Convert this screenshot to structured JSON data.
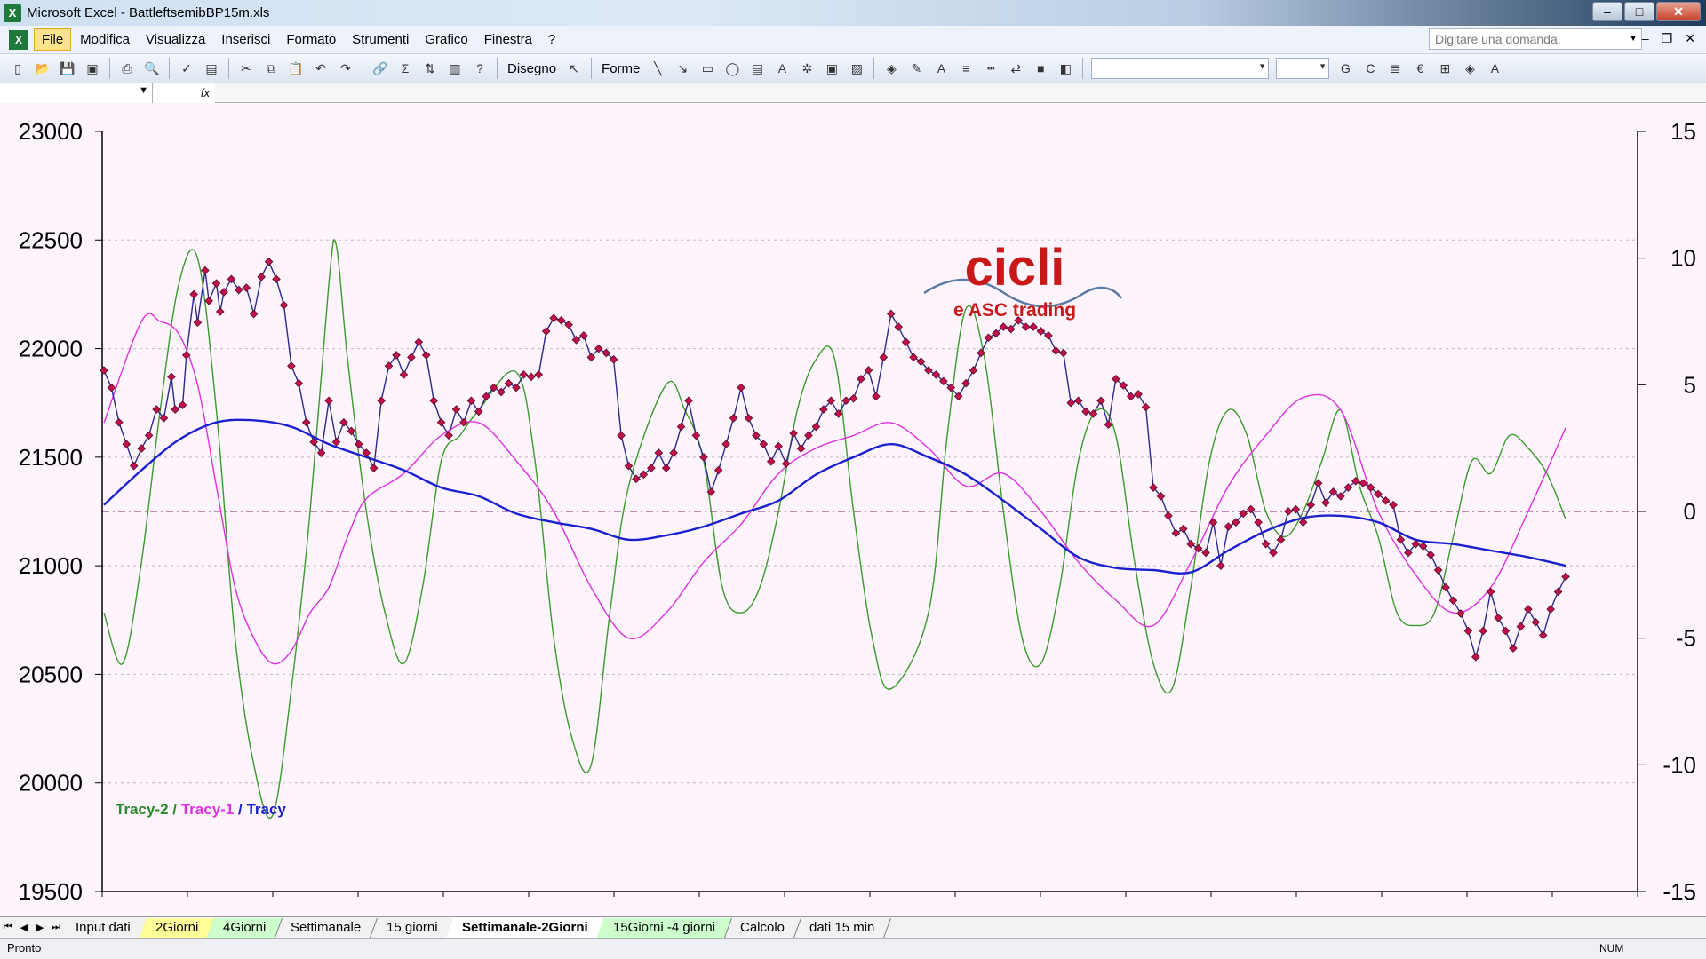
{
  "window": {
    "app": "Microsoft Excel",
    "title": "Microsoft Excel - BattleftsemibBP15m.xls"
  },
  "menu": {
    "items": [
      "File",
      "Modifica",
      "Visualizza",
      "Inserisci",
      "Formato",
      "Strumenti",
      "Grafico",
      "Finestra",
      "?"
    ],
    "ask_placeholder": "Digitare una domanda."
  },
  "toolbar": {
    "drawing_label": "Disegno",
    "shapes_label": "Forme"
  },
  "formula_bar": {
    "fx": "fx"
  },
  "sheet_tabs": [
    {
      "label": "Input dati",
      "style": "plain"
    },
    {
      "label": "2Giorni",
      "style": "yellow"
    },
    {
      "label": "4Giorni",
      "style": "green"
    },
    {
      "label": "Settimanale",
      "style": "plain"
    },
    {
      "label": "15 giorni",
      "style": "plain"
    },
    {
      "label": "Settimanale-2Giorni",
      "style": "active"
    },
    {
      "label": "15Giorni -4 giorni",
      "style": "green"
    },
    {
      "label": "Calcolo",
      "style": "plain"
    },
    {
      "label": "dati 15 min",
      "style": "plain"
    }
  ],
  "status": {
    "left": "Pronto",
    "num": "NUM"
  },
  "logo": {
    "line1": "cicli",
    "line2": "e ASC trading"
  },
  "colors": {
    "tracy2": "#3a9a2a",
    "tracy1": "#e030e0",
    "tracy": "#1a20d0",
    "price": "#2a2a8a",
    "marker": "#c0104a",
    "chart_bg": "#fdf4fd"
  },
  "chart_data": {
    "type": "line",
    "legend": [
      {
        "name": "Tracy-2",
        "color": "#2a8a2a"
      },
      {
        "name": "Tracy-1",
        "color": "#e030e0"
      },
      {
        "name": "Tracy",
        "color": "#1a20d0"
      }
    ],
    "y_left": {
      "min": 19500,
      "max": 23000,
      "ticks": [
        19500,
        20000,
        20500,
        21000,
        21500,
        22000,
        22500,
        23000
      ]
    },
    "y_right": {
      "min": -15,
      "max": 15,
      "ticks": [
        -15,
        -10,
        -5,
        0,
        5,
        10,
        15
      ]
    },
    "n_points": 180,
    "x_ticks": 18,
    "price": [
      [
        0,
        21900
      ],
      [
        2,
        21820
      ],
      [
        4,
        21660
      ],
      [
        6,
        21560
      ],
      [
        8,
        21460
      ],
      [
        10,
        21540
      ],
      [
        12,
        21600
      ],
      [
        14,
        21720
      ],
      [
        16,
        21680
      ],
      [
        18,
        21870
      ],
      [
        19,
        21720
      ],
      [
        21,
        21740
      ],
      [
        22,
        21970
      ],
      [
        24,
        22250
      ],
      [
        25,
        22120
      ],
      [
        27,
        22360
      ],
      [
        28,
        22220
      ],
      [
        30,
        22300
      ],
      [
        31,
        22170
      ],
      [
        32,
        22260
      ],
      [
        34,
        22320
      ],
      [
        36,
        22270
      ],
      [
        38,
        22280
      ],
      [
        40,
        22160
      ],
      [
        42,
        22330
      ],
      [
        44,
        22400
      ],
      [
        46,
        22320
      ],
      [
        48,
        22200
      ],
      [
        50,
        21920
      ],
      [
        52,
        21840
      ],
      [
        54,
        21660
      ],
      [
        56,
        21570
      ],
      [
        58,
        21520
      ],
      [
        60,
        21760
      ],
      [
        62,
        21570
      ],
      [
        64,
        21660
      ],
      [
        66,
        21620
      ],
      [
        68,
        21560
      ],
      [
        70,
        21520
      ],
      [
        72,
        21450
      ],
      [
        74,
        21760
      ],
      [
        76,
        21920
      ],
      [
        78,
        21970
      ],
      [
        80,
        21880
      ],
      [
        82,
        21960
      ],
      [
        84,
        22030
      ],
      [
        86,
        21970
      ],
      [
        88,
        21760
      ],
      [
        90,
        21660
      ],
      [
        92,
        21600
      ],
      [
        94,
        21720
      ],
      [
        96,
        21660
      ],
      [
        98,
        21760
      ],
      [
        100,
        21710
      ],
      [
        102,
        21780
      ],
      [
        104,
        21820
      ],
      [
        106,
        21800
      ],
      [
        108,
        21840
      ],
      [
        110,
        21820
      ],
      [
        112,
        21880
      ],
      [
        114,
        21870
      ],
      [
        116,
        21880
      ],
      [
        118,
        22080
      ],
      [
        120,
        22140
      ],
      [
        122,
        22130
      ],
      [
        124,
        22110
      ],
      [
        126,
        22040
      ],
      [
        128,
        22060
      ],
      [
        130,
        21960
      ],
      [
        132,
        22000
      ],
      [
        134,
        21980
      ],
      [
        136,
        21950
      ],
      [
        138,
        21600
      ],
      [
        140,
        21460
      ],
      [
        142,
        21400
      ],
      [
        144,
        21420
      ],
      [
        146,
        21450
      ],
      [
        148,
        21520
      ],
      [
        150,
        21450
      ],
      [
        152,
        21520
      ],
      [
        154,
        21640
      ],
      [
        156,
        21760
      ],
      [
        158,
        21600
      ],
      [
        160,
        21500
      ],
      [
        162,
        21340
      ],
      [
        164,
        21440
      ],
      [
        166,
        21560
      ],
      [
        168,
        21680
      ],
      [
        170,
        21820
      ],
      [
        172,
        21680
      ],
      [
        174,
        21600
      ],
      [
        176,
        21560
      ],
      [
        178,
        21480
      ],
      [
        180,
        21550
      ],
      [
        182,
        21470
      ],
      [
        184,
        21610
      ],
      [
        186,
        21540
      ],
      [
        188,
        21600
      ],
      [
        190,
        21640
      ],
      [
        192,
        21720
      ],
      [
        194,
        21760
      ],
      [
        196,
        21700
      ],
      [
        198,
        21760
      ],
      [
        200,
        21770
      ],
      [
        202,
        21860
      ],
      [
        204,
        21900
      ],
      [
        206,
        21780
      ],
      [
        208,
        21960
      ],
      [
        210,
        22160
      ],
      [
        212,
        22100
      ],
      [
        214,
        22030
      ],
      [
        216,
        21960
      ],
      [
        218,
        21940
      ],
      [
        220,
        21900
      ],
      [
        222,
        21880
      ],
      [
        224,
        21850
      ],
      [
        226,
        21820
      ],
      [
        228,
        21780
      ],
      [
        230,
        21840
      ],
      [
        232,
        21900
      ],
      [
        234,
        21980
      ],
      [
        236,
        22050
      ],
      [
        238,
        22070
      ],
      [
        240,
        22100
      ],
      [
        242,
        22090
      ],
      [
        244,
        22130
      ],
      [
        246,
        22100
      ],
      [
        248,
        22100
      ],
      [
        250,
        22080
      ],
      [
        252,
        22060
      ],
      [
        254,
        21990
      ],
      [
        256,
        21980
      ],
      [
        258,
        21750
      ],
      [
        260,
        21760
      ],
      [
        262,
        21710
      ],
      [
        264,
        21700
      ],
      [
        266,
        21760
      ],
      [
        268,
        21650
      ],
      [
        270,
        21860
      ],
      [
        272,
        21830
      ],
      [
        274,
        21780
      ],
      [
        276,
        21790
      ],
      [
        278,
        21730
      ],
      [
        280,
        21360
      ],
      [
        282,
        21320
      ],
      [
        284,
        21230
      ],
      [
        286,
        21150
      ],
      [
        288,
        21170
      ],
      [
        290,
        21100
      ],
      [
        292,
        21080
      ],
      [
        294,
        21060
      ],
      [
        296,
        21200
      ],
      [
        298,
        21000
      ],
      [
        300,
        21180
      ],
      [
        302,
        21200
      ],
      [
        304,
        21240
      ],
      [
        306,
        21260
      ],
      [
        308,
        21200
      ],
      [
        310,
        21100
      ],
      [
        312,
        21060
      ],
      [
        314,
        21120
      ],
      [
        316,
        21250
      ],
      [
        318,
        21260
      ],
      [
        320,
        21200
      ],
      [
        322,
        21280
      ],
      [
        324,
        21380
      ],
      [
        326,
        21290
      ],
      [
        328,
        21340
      ],
      [
        330,
        21320
      ],
      [
        332,
        21360
      ],
      [
        334,
        21390
      ],
      [
        336,
        21380
      ],
      [
        338,
        21360
      ],
      [
        340,
        21330
      ],
      [
        342,
        21300
      ],
      [
        344,
        21280
      ],
      [
        346,
        21120
      ],
      [
        348,
        21060
      ],
      [
        350,
        21100
      ],
      [
        352,
        21090
      ],
      [
        354,
        21050
      ],
      [
        356,
        20980
      ],
      [
        358,
        20900
      ],
      [
        360,
        20840
      ],
      [
        362,
        20780
      ],
      [
        364,
        20700
      ],
      [
        366,
        20580
      ],
      [
        368,
        20700
      ],
      [
        370,
        20880
      ],
      [
        372,
        20760
      ],
      [
        374,
        20700
      ],
      [
        376,
        20620
      ],
      [
        378,
        20720
      ],
      [
        380,
        20800
      ],
      [
        382,
        20740
      ],
      [
        384,
        20680
      ],
      [
        386,
        20800
      ],
      [
        388,
        20880
      ],
      [
        390,
        20950
      ]
    ],
    "tracy": [
      [
        0,
        21280
      ],
      [
        10,
        21440
      ],
      [
        20,
        21580
      ],
      [
        30,
        21660
      ],
      [
        40,
        21670
      ],
      [
        50,
        21640
      ],
      [
        60,
        21560
      ],
      [
        70,
        21500
      ],
      [
        80,
        21440
      ],
      [
        90,
        21360
      ],
      [
        100,
        21320
      ],
      [
        110,
        21240
      ],
      [
        120,
        21200
      ],
      [
        130,
        21170
      ],
      [
        140,
        21120
      ],
      [
        150,
        21140
      ],
      [
        160,
        21180
      ],
      [
        170,
        21240
      ],
      [
        180,
        21300
      ],
      [
        190,
        21420
      ],
      [
        200,
        21500
      ],
      [
        210,
        21560
      ],
      [
        220,
        21500
      ],
      [
        230,
        21420
      ],
      [
        240,
        21300
      ],
      [
        250,
        21170
      ],
      [
        260,
        21040
      ],
      [
        270,
        20990
      ],
      [
        280,
        20980
      ],
      [
        290,
        20970
      ],
      [
        300,
        21070
      ],
      [
        310,
        21160
      ],
      [
        320,
        21220
      ],
      [
        330,
        21230
      ],
      [
        340,
        21200
      ],
      [
        350,
        21120
      ],
      [
        360,
        21100
      ],
      [
        370,
        21070
      ],
      [
        380,
        21040
      ],
      [
        390,
        21000
      ]
    ],
    "tracy1": [
      [
        0,
        3.5
      ],
      [
        10,
        7.5
      ],
      [
        15,
        7.5
      ],
      [
        20,
        7
      ],
      [
        25,
        5
      ],
      [
        30,
        1
      ],
      [
        35,
        -3
      ],
      [
        40,
        -5
      ],
      [
        45,
        -6
      ],
      [
        50,
        -5.5
      ],
      [
        55,
        -4
      ],
      [
        60,
        -3
      ],
      [
        65,
        -1
      ],
      [
        70,
        0.5
      ],
      [
        80,
        1.5
      ],
      [
        90,
        3
      ],
      [
        100,
        3.5
      ],
      [
        110,
        2
      ],
      [
        120,
        0
      ],
      [
        130,
        -3
      ],
      [
        140,
        -5
      ],
      [
        150,
        -4
      ],
      [
        160,
        -2
      ],
      [
        170,
        -0.5
      ],
      [
        180,
        1.5
      ],
      [
        190,
        2.5
      ],
      [
        200,
        3
      ],
      [
        210,
        3.5
      ],
      [
        220,
        2.5
      ],
      [
        230,
        1
      ],
      [
        240,
        1.5
      ],
      [
        250,
        0
      ],
      [
        260,
        -2
      ],
      [
        270,
        -3.5
      ],
      [
        280,
        -4.5
      ],
      [
        290,
        -2
      ],
      [
        300,
        1
      ],
      [
        310,
        3
      ],
      [
        320,
        4.5
      ],
      [
        330,
        4
      ],
      [
        340,
        0
      ],
      [
        350,
        -2.5
      ],
      [
        360,
        -4
      ],
      [
        370,
        -3
      ],
      [
        380,
        0
      ],
      [
        390,
        3.3
      ]
    ],
    "tracy2": [
      [
        0,
        -4
      ],
      [
        5,
        -6
      ],
      [
        10,
        -2
      ],
      [
        15,
        4
      ],
      [
        20,
        9
      ],
      [
        25,
        10
      ],
      [
        30,
        4
      ],
      [
        35,
        -5
      ],
      [
        40,
        -10
      ],
      [
        45,
        -12
      ],
      [
        50,
        -7
      ],
      [
        55,
        0
      ],
      [
        60,
        9
      ],
      [
        62,
        10.5
      ],
      [
        65,
        6
      ],
      [
        70,
        0
      ],
      [
        75,
        -4
      ],
      [
        80,
        -6
      ],
      [
        85,
        -3
      ],
      [
        90,
        2
      ],
      [
        95,
        3
      ],
      [
        100,
        4
      ],
      [
        110,
        5.5
      ],
      [
        115,
        2
      ],
      [
        120,
        -5
      ],
      [
        125,
        -9
      ],
      [
        130,
        -10
      ],
      [
        135,
        -4
      ],
      [
        140,
        1
      ],
      [
        150,
        5
      ],
      [
        155,
        4
      ],
      [
        160,
        2
      ],
      [
        165,
        -3
      ],
      [
        170,
        -4
      ],
      [
        175,
        -3
      ],
      [
        180,
        0
      ],
      [
        185,
        4
      ],
      [
        190,
        6
      ],
      [
        195,
        6
      ],
      [
        200,
        0
      ],
      [
        205,
        -5
      ],
      [
        210,
        -7
      ],
      [
        220,
        -4
      ],
      [
        225,
        3
      ],
      [
        230,
        8
      ],
      [
        235,
        6
      ],
      [
        240,
        0
      ],
      [
        245,
        -5
      ],
      [
        250,
        -6
      ],
      [
        255,
        -3
      ],
      [
        260,
        2
      ],
      [
        265,
        4
      ],
      [
        270,
        3
      ],
      [
        275,
        -2
      ],
      [
        280,
        -6
      ],
      [
        285,
        -7
      ],
      [
        290,
        -3
      ],
      [
        295,
        2
      ],
      [
        300,
        4
      ],
      [
        305,
        3
      ],
      [
        310,
        0
      ],
      [
        315,
        -1
      ],
      [
        320,
        0
      ],
      [
        325,
        2
      ],
      [
        330,
        4
      ],
      [
        335,
        1
      ],
      [
        340,
        -1
      ],
      [
        345,
        -4
      ],
      [
        350,
        -4.5
      ],
      [
        355,
        -4
      ],
      [
        360,
        -1
      ],
      [
        365,
        2
      ],
      [
        370,
        1.5
      ],
      [
        375,
        3
      ],
      [
        380,
        2.5
      ],
      [
        385,
        1.5
      ],
      [
        390,
        -0.3
      ]
    ]
  }
}
